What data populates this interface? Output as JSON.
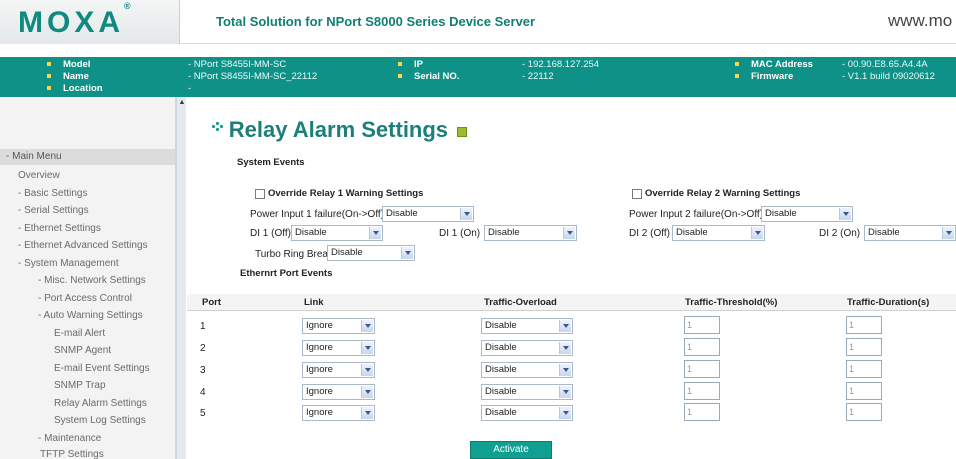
{
  "header": {
    "logo": "MOXA",
    "logo_mark": "®",
    "tagline": "Total Solution for NPort S8000 Series Device Server",
    "site_url": "www.mo"
  },
  "info": {
    "model_label": "Model",
    "model_value": "- NPort S8455I-MM-SC",
    "name_label": "Name",
    "name_value": "- NPort S8455I-MM-SC_22112",
    "location_label": "Location",
    "location_value": "-",
    "ip_label": "IP",
    "ip_value": "- 192.168.127.254",
    "serial_label": "Serial NO.",
    "serial_value": "- 22112",
    "mac_label": "MAC Address",
    "mac_value": "- 00.90.E8.65.A4.4A",
    "firmware_label": "Firmware",
    "firmware_value": "- V1.1 build 09020612"
  },
  "menu": {
    "title": "- Main Menu",
    "items": [
      "Overview",
      "- Basic Settings",
      "- Serial Settings",
      "- Ethernet Settings",
      "- Ethernet Advanced Settings",
      "- System Management",
      "- Misc. Network Settings",
      "- Port Access Control",
      "- Auto Warning Settings",
      "E-mail Alert",
      "SNMP Agent",
      "E-mail Event Settings",
      "SNMP Trap",
      "Relay Alarm Settings",
      "System Log Settings",
      "- Maintenance",
      "TFTP Settings"
    ]
  },
  "page": {
    "title": "Relay Alarm Settings",
    "system_events_heading": "System Events",
    "override_relay1": "Override Relay 1 Warning Settings",
    "override_relay2": "Override Relay 2 Warning Settings",
    "power_input1_label": "Power Input 1 failure(On->Off)",
    "power_input1_value": "Disable",
    "power_input2_label": "Power Input 2 failure(On->Off)",
    "power_input2_value": "Disable",
    "di1_off_label": "DI 1 (Off)",
    "di1_off_value": "Disable",
    "di1_on_label": "DI 1 (On)",
    "di1_on_value": "Disable",
    "di2_off_label": "DI 2 (Off)",
    "di2_off_value": "Disable",
    "di2_on_label": "DI 2 (On)",
    "di2_on_value": "Disable",
    "turbo_ring_label": "Turbo Ring Break",
    "turbo_ring_value": "Disable",
    "ethernet_events_heading": "Ethernrt Port Events",
    "columns": [
      "Port",
      "Link",
      "Traffic-Overload",
      "Traffic-Threshold(%)",
      "Traffic-Duration(s)"
    ],
    "rows": [
      {
        "port": "1",
        "link": "Ignore",
        "overload": "Disable",
        "threshold": "1",
        "duration": "1"
      },
      {
        "port": "2",
        "link": "Ignore",
        "overload": "Disable",
        "threshold": "1",
        "duration": "1"
      },
      {
        "port": "3",
        "link": "Ignore",
        "overload": "Disable",
        "threshold": "1",
        "duration": "1"
      },
      {
        "port": "4",
        "link": "Ignore",
        "overload": "Disable",
        "threshold": "1",
        "duration": "1"
      },
      {
        "port": "5",
        "link": "Ignore",
        "overload": "Disable",
        "threshold": "1",
        "duration": "1"
      }
    ],
    "activate_label": "Activate"
  },
  "colors": {
    "brand_teal": "#0e9186",
    "title_teal": "#1c7f7a"
  }
}
